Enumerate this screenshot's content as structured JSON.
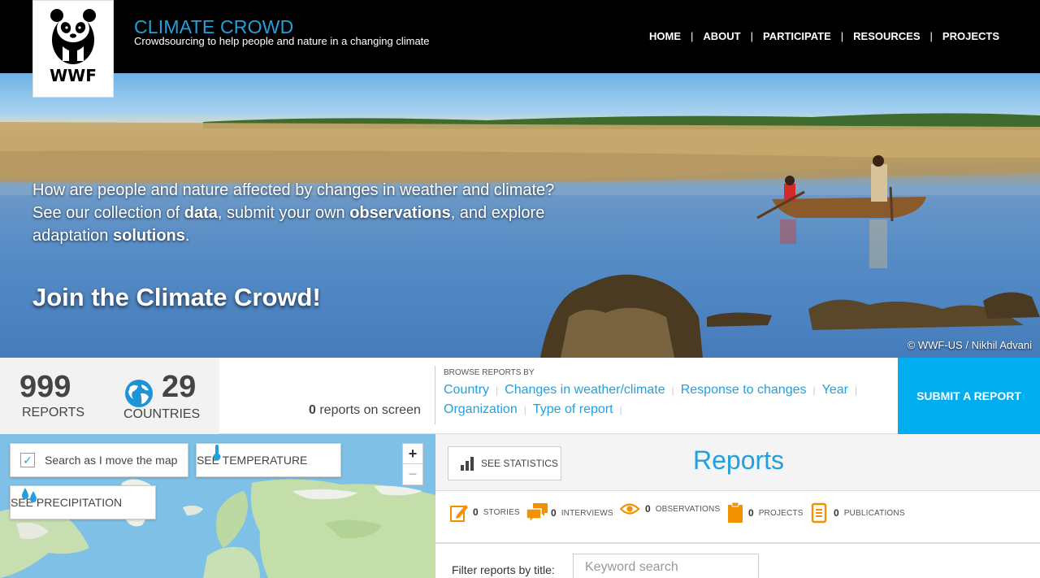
{
  "header": {
    "logo_text": "WWF",
    "site_title": "CLIMATE CROWD",
    "site_subtitle": "Crowdsourcing to help people and nature in a changing climate",
    "nav": [
      "HOME",
      "ABOUT",
      "PARTICIPATE",
      "RESOURCES",
      "PROJECTS"
    ],
    "nav_separator": "|"
  },
  "hero": {
    "line1": "How are people and nature affected by changes in weather and climate?",
    "line2_a": "See our collection of ",
    "line2_b": "data",
    "line2_c": ", submit your own ",
    "line2_d": "observations",
    "line2_e": ", and explore",
    "line3_a": "adaptation ",
    "line3_b": "solutions",
    "line3_c": ".",
    "cta": "Join the Climate Crowd!",
    "credit": "© WWF-US / Nikhil Advani"
  },
  "stats": {
    "reports_count": "999",
    "reports_label": "REPORTS",
    "countries_count": "29",
    "countries_label": "COUNTRIES",
    "on_screen_count": "0",
    "on_screen_label": " reports on screen",
    "globe_icon": "globe-icon"
  },
  "browse": {
    "label": "BROWSE REPORTS BY",
    "links": [
      "Country",
      "Changes in weather/climate",
      "Response to changes",
      "Year",
      "Organization",
      "Type of report"
    ],
    "separator": "|"
  },
  "submit_label": "SUBMIT A REPORT",
  "map": {
    "search_checkbox_label": "Search as I move the map",
    "search_checked": true,
    "temperature_label": "SEE TEMPERATURE",
    "precipitation_label": "SEE PRECIPITATION",
    "zoom_in": "+",
    "zoom_out": "−"
  },
  "reports": {
    "statistics_label": "SEE STATISTICS",
    "title": "Reports",
    "counts": [
      {
        "icon": "pencil-icon",
        "count": "0",
        "label": "STORIES"
      },
      {
        "icon": "chat-icon",
        "count": "0",
        "label": "INTERVIEWS"
      },
      {
        "icon": "eye-icon",
        "count": "0",
        "label": "OBSERVATIONS"
      },
      {
        "icon": "clipboard-icon",
        "count": "0",
        "label": "PROJECTS"
      },
      {
        "icon": "document-icon",
        "count": "0",
        "label": "PUBLICATIONS"
      }
    ],
    "filter_label": "Filter reports by title:",
    "filter_placeholder": "Keyword search"
  },
  "colors": {
    "accent_blue": "#22a0de",
    "submit_blue": "#00aeef",
    "icon_orange": "#f39200",
    "header_black": "#000000"
  }
}
